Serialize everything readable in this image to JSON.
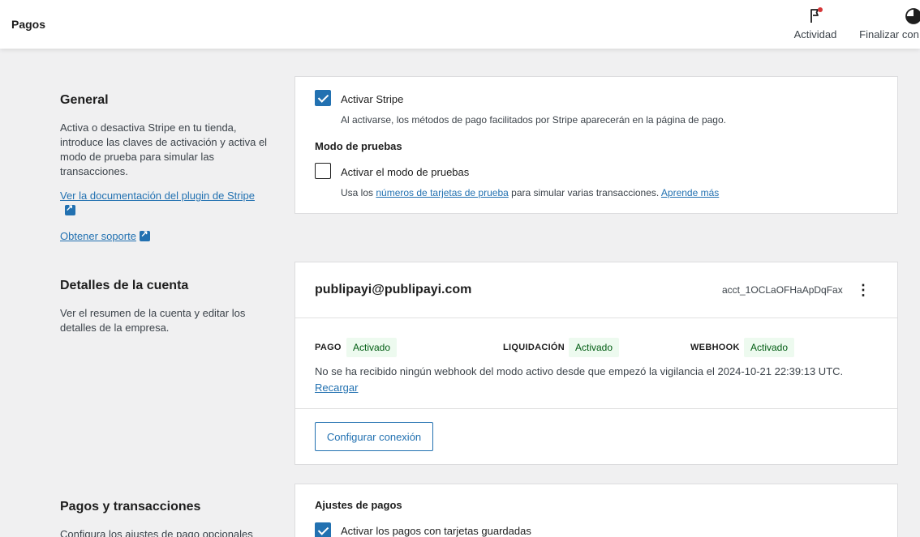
{
  "header": {
    "title": "Pagos",
    "activity_label": "Actividad",
    "finish_label": "Finalizar con"
  },
  "general": {
    "title": "General",
    "description": "Activa o desactiva Stripe en tu tienda, introduce las claves de activación y activa el modo de prueba para simular las transacciones.",
    "doc_link": "Ver la documentación del plugin de Stripe",
    "support_link": "Obtener soporte",
    "enable_stripe_label": "Activar Stripe",
    "enable_stripe_checked": true,
    "enable_stripe_help": "Al activarse, los métodos de pago facilitados por Stripe aparecerán en la página de pago.",
    "test_mode_heading": "Modo de pruebas",
    "test_mode_label": "Activar el modo de pruebas",
    "test_mode_checked": false,
    "test_help_prefix": "Usa los",
    "test_help_link": "números de tarjetas de prueba",
    "test_help_middle": "para simular varias transacciones.",
    "test_help_learn": "Aprende más"
  },
  "account": {
    "title": "Detalles de la cuenta",
    "description": "Ver el resumen de la cuenta y editar los detalles de la empresa.",
    "email": "publipayi@publipayi.com",
    "account_id": "acct_1OCLaOFHaApDqFax",
    "menu_icon": "kebab-icon",
    "status": [
      {
        "label": "PAGO",
        "value": "Activado"
      },
      {
        "label": "LIQUIDACIÓN",
        "value": "Activado"
      },
      {
        "label": "WEBHOOK",
        "value": "Activado"
      }
    ],
    "webhook_message": "No se ha recibido ningún webhook del modo activo desde que empezó la vigilancia el 2024-10-21 22:39:13 UTC.",
    "reload_link": "Recargar",
    "configure_button": "Configurar conexión"
  },
  "payments": {
    "title": "Pagos y transacciones",
    "description": "Configura los ajustes de pago opcionales",
    "settings_heading": "Ajustes de pagos",
    "saved_cards_label": "Activar los pagos con tarjetas guardadas",
    "saved_cards_checked": true
  },
  "colors": {
    "accent": "#2271b1",
    "badge_bg": "#edfaef",
    "badge_text": "#005c12",
    "notification_dot": "#d63638"
  }
}
